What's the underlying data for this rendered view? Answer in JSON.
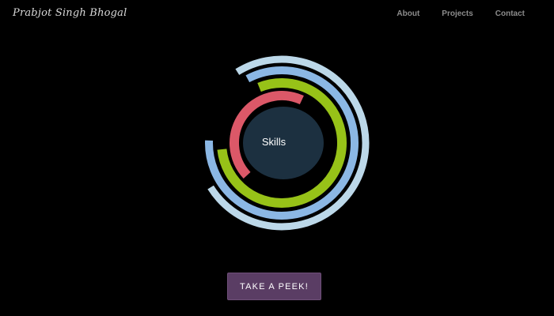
{
  "header": {
    "brand": "Prabjot Singh Bhogal",
    "nav": [
      {
        "label": "About"
      },
      {
        "label": "Projects"
      },
      {
        "label": "Contact"
      }
    ]
  },
  "skills": {
    "label": "Skills",
    "colors": {
      "core": "#1c3040",
      "outer_ring": "#bcd8e9",
      "blue_ring": "#8bb7e4",
      "green_ring": "#97c218",
      "red_ring": "#db5868"
    }
  },
  "cta": {
    "label": "TAKE A PEEK!"
  }
}
